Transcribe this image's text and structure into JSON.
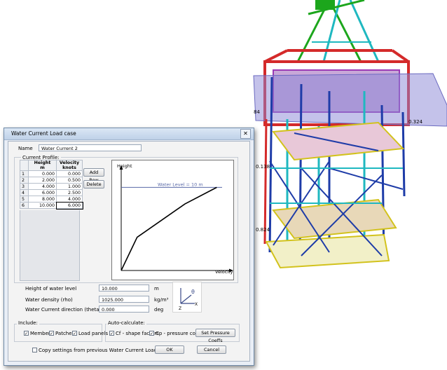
{
  "window": {
    "title": "Water Current Load case",
    "close_glyph": "✕"
  },
  "name": {
    "label": "Name",
    "value": "Water Current 2"
  },
  "profile": {
    "label": "Current Profile:",
    "headers": {
      "height_line1": "Height",
      "height_line2": "m",
      "velocity_line1": "Velocity",
      "velocity_line2": "knots"
    },
    "rows": [
      {
        "idx": "1",
        "height": "0.000",
        "velocity": "0.000"
      },
      {
        "idx": "2",
        "height": "2.000",
        "velocity": "0.500"
      },
      {
        "idx": "3",
        "height": "4.000",
        "velocity": "1.000"
      },
      {
        "idx": "4",
        "height": "6.000",
        "velocity": "2.500"
      },
      {
        "idx": "5",
        "height": "8.000",
        "velocity": "4.000"
      },
      {
        "idx": "6",
        "height": "10.000",
        "velocity": "6.000"
      }
    ],
    "add_row": "Add Row",
    "delete": "Delete"
  },
  "chart_data": {
    "type": "line",
    "x": [
      0,
      0.5,
      1,
      2.5,
      4,
      6
    ],
    "y": [
      0,
      2,
      4,
      6,
      8,
      10
    ],
    "xlabel": "Velocity",
    "ylabel": "Height",
    "xlim": [
      0,
      6.6
    ],
    "ylim": [
      0,
      11.8
    ],
    "annotations": [
      {
        "text": "Water Level = 10 m",
        "y": 10,
        "color": "#5a6aa8"
      }
    ]
  },
  "params": {
    "height_label": "Height of water level",
    "height_value": "10.000",
    "height_unit": "m",
    "density_label": "Water density (rho)",
    "density_value": "1025.000",
    "density_unit": "kg/m³",
    "direction_label": "Water Current direction (theta)",
    "direction_value": "0.000",
    "direction_unit": "deg"
  },
  "axis_glyph": {
    "theta": "θ",
    "x": "X",
    "z": "Z"
  },
  "include": {
    "label": "Include:",
    "members": {
      "label": "Members",
      "checked": true
    },
    "patches": {
      "label": "Patches",
      "checked": true
    },
    "load_panels": {
      "label": "Load panels",
      "checked": true
    }
  },
  "autocalc": {
    "label": "Auto-calculate:",
    "cf": {
      "label": "Cf - shape factors",
      "checked": true
    },
    "cp": {
      "label": "Cp - pressure coeffs",
      "checked": true
    },
    "set_button": "Set Pressure Coeffs"
  },
  "copy_settings": {
    "label": "Copy settings from previous Water Current Load Case",
    "checked": false
  },
  "buttons": {
    "ok": "OK",
    "cancel": "Cancel"
  },
  "model_labels": {
    "top_right": "0.324",
    "left_a": "0.138",
    "left_b": "0.824",
    "left_c": "84"
  },
  "colors": {
    "plot_line": "#000000",
    "water_level": "#5a6aa8",
    "sea_plane": "#8a86d6"
  }
}
